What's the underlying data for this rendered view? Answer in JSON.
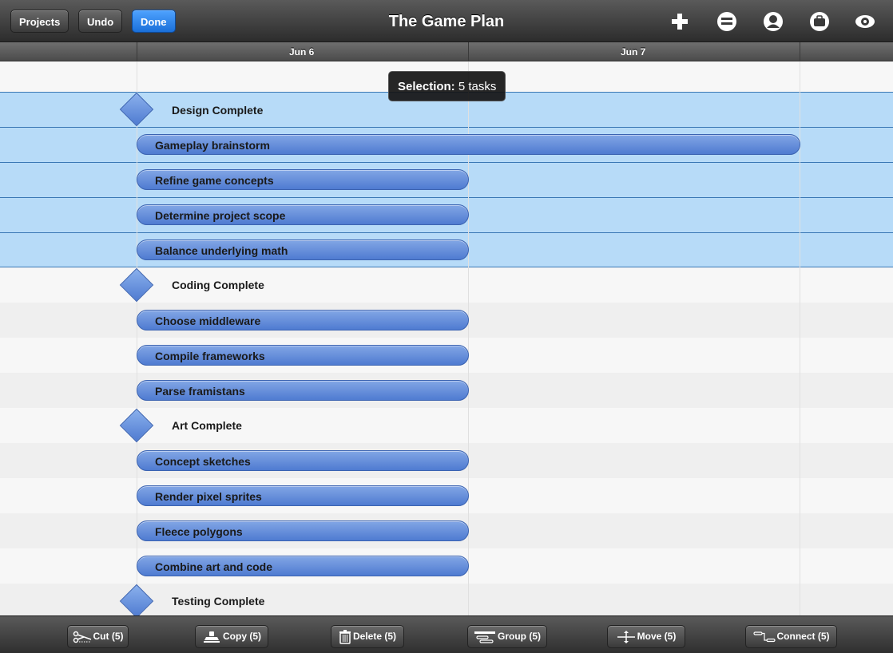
{
  "toolbar": {
    "projects_label": "Projects",
    "undo_label": "Undo",
    "done_label": "Done",
    "title": "The Game Plan",
    "icons": [
      "add-icon",
      "minus-circle-icon",
      "person-icon",
      "briefcase-icon",
      "eye-icon"
    ]
  },
  "timeline": {
    "dates": [
      "Jun 6",
      "Jun 7"
    ]
  },
  "selection": {
    "prefix": "Selection:",
    "value": "5 tasks"
  },
  "rows": [
    {
      "type": "milestone",
      "label": "Design Complete",
      "selected": true
    },
    {
      "type": "task",
      "label": "Gameplay brainstorm",
      "selected": true
    },
    {
      "type": "task",
      "label": "Refine game concepts",
      "selected": true
    },
    {
      "type": "task",
      "label": "Determine project scope",
      "selected": true
    },
    {
      "type": "task",
      "label": "Balance underlying math",
      "selected": true
    },
    {
      "type": "milestone",
      "label": "Coding Complete",
      "selected": false
    },
    {
      "type": "task",
      "label": "Choose middleware",
      "selected": false
    },
    {
      "type": "task",
      "label": "Compile frameworks",
      "selected": false
    },
    {
      "type": "task",
      "label": "Parse framistans",
      "selected": false
    },
    {
      "type": "milestone",
      "label": "Art Complete",
      "selected": false
    },
    {
      "type": "task",
      "label": "Concept sketches",
      "selected": false
    },
    {
      "type": "task",
      "label": "Render pixel sprites",
      "selected": false
    },
    {
      "type": "task",
      "label": "Fleece polygons",
      "selected": false
    },
    {
      "type": "task",
      "label": "Combine art and code",
      "selected": false
    },
    {
      "type": "milestone",
      "label": "Testing Complete",
      "selected": false
    }
  ],
  "bottom_actions": {
    "cut": "Cut (5)",
    "copy": "Copy (5)",
    "delete": "Delete (5)",
    "group": "Group (5)",
    "move": "Move (5)",
    "connect": "Connect (5)"
  },
  "colors": {
    "selection_bg": "#b7dbf8",
    "bar_fill": "#5e88d8",
    "done_button": "#2a86f0"
  }
}
